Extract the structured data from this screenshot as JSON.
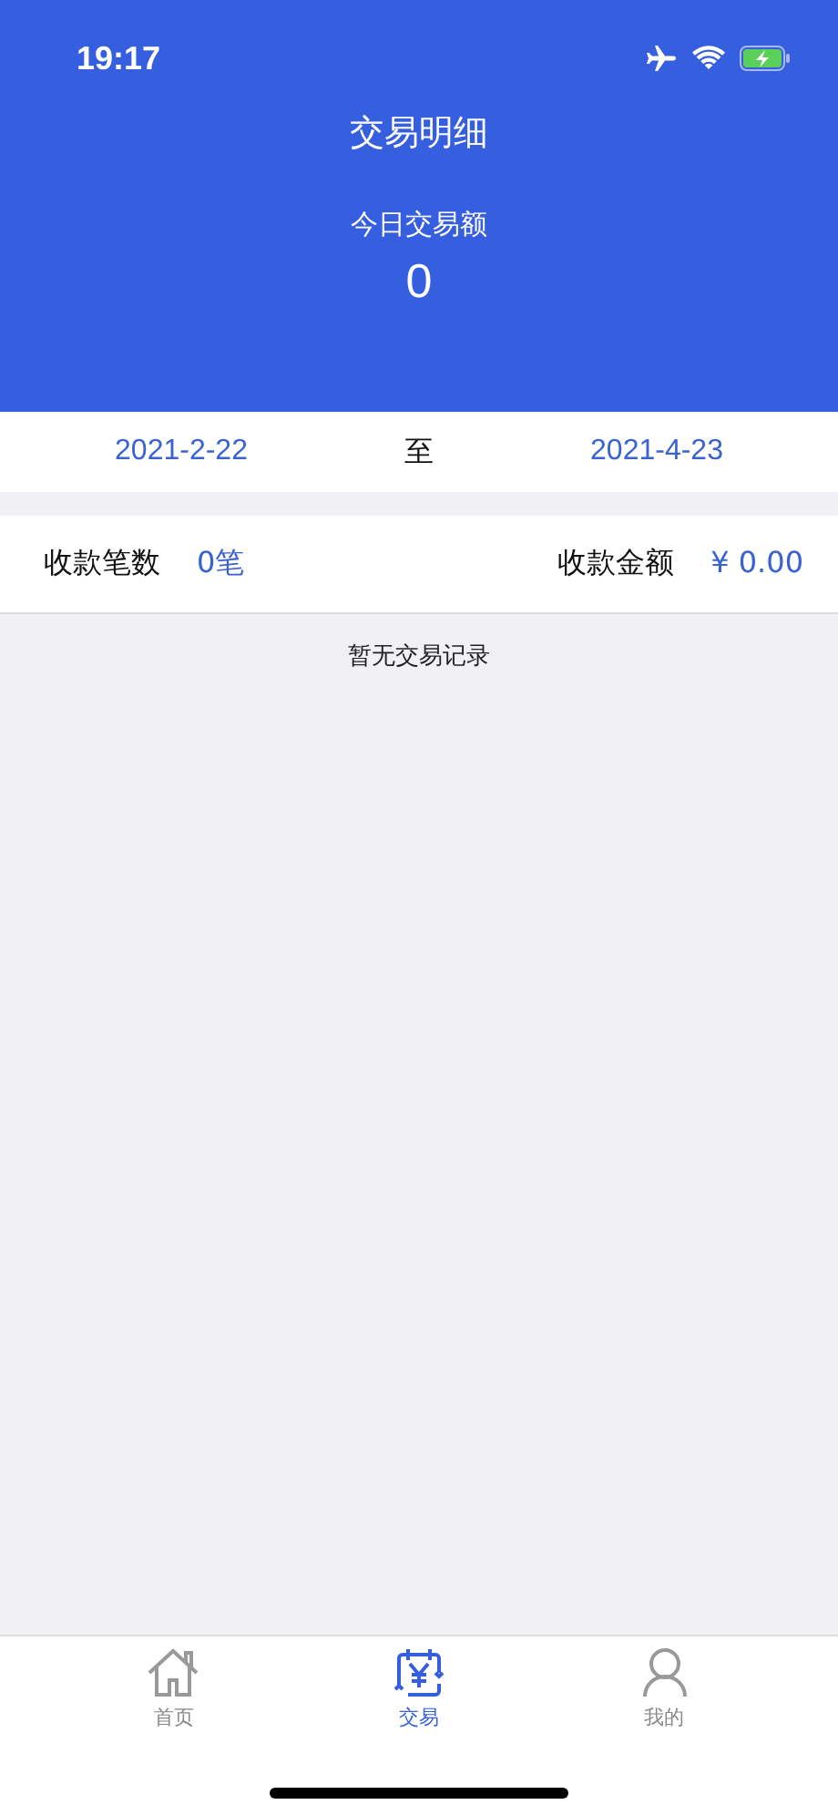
{
  "status_bar": {
    "time": "19:17"
  },
  "header": {
    "title": "交易明细",
    "today_label": "今日交易额",
    "today_value": "0"
  },
  "date_range": {
    "start": "2021-2-22",
    "separator": "至",
    "end": "2021-4-23"
  },
  "summary": {
    "count_label": "收款笔数",
    "count_value": "0笔",
    "amount_label": "收款金额",
    "amount_value": "¥ 0.00"
  },
  "empty_message": "暂无交易记录",
  "tabs": [
    {
      "kind": "home",
      "label": "首页",
      "selected": false
    },
    {
      "kind": "transaction",
      "label": "交易",
      "selected": true
    },
    {
      "kind": "profile",
      "label": "我的",
      "selected": false
    }
  ]
}
